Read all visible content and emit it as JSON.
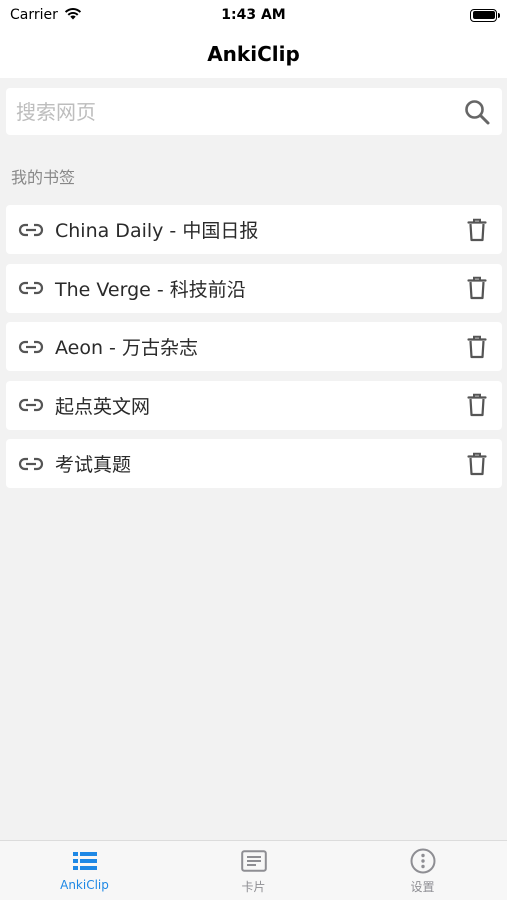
{
  "status_bar": {
    "carrier": "Carrier",
    "time": "1:43 AM"
  },
  "nav": {
    "title": "AnkiClip"
  },
  "search": {
    "placeholder": "搜索网页",
    "value": ""
  },
  "bookmarks": {
    "section_label": "我的书签",
    "items": [
      {
        "label": "China Daily - 中国日报"
      },
      {
        "label": "The Verge - 科技前沿"
      },
      {
        "label": "Aeon - 万古杂志"
      },
      {
        "label": "起点英文网"
      },
      {
        "label": "考试真题"
      }
    ]
  },
  "tab_bar": {
    "tabs": [
      {
        "label": "AnkiClip",
        "icon": "list-icon",
        "active": true
      },
      {
        "label": "卡片",
        "icon": "card-icon",
        "active": false
      },
      {
        "label": "设置",
        "icon": "info-circle-icon",
        "active": false
      }
    ]
  },
  "colors": {
    "accent": "#1e88e5",
    "background": "#f2f2f2",
    "inactive_tab": "#8e8e93"
  }
}
